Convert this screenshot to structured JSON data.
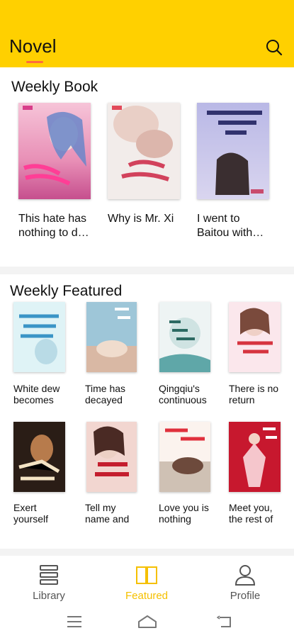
{
  "header": {
    "title": "Novel",
    "search_icon": "search-icon",
    "background": "#ffd000",
    "accent": "#ff6b3d"
  },
  "weekly_book": {
    "title": "Weekly Book",
    "books": [
      {
        "title": "This hate has nothing to do with the wind"
      },
      {
        "title": "Why is Mr. Xi"
      },
      {
        "title": "I went to Baitou with you"
      }
    ]
  },
  "weekly_featured": {
    "title": "Weekly Featured",
    "books": [
      {
        "title": "White dew becomes"
      },
      {
        "title": "Time has decayed"
      },
      {
        "title": "Qingqiu's continuous"
      },
      {
        "title": "There is no return"
      },
      {
        "title": "Exert yourself"
      },
      {
        "title": "Tell my name and"
      },
      {
        "title": "Love you is nothing"
      },
      {
        "title": "Meet you, the rest of"
      }
    ]
  },
  "bottom_nav": {
    "items": [
      {
        "label": "Library",
        "icon": "library-icon",
        "active": false
      },
      {
        "label": "Featured",
        "icon": "book-open-icon",
        "active": true
      },
      {
        "label": "Profile",
        "icon": "profile-icon",
        "active": false
      }
    ],
    "active_color": "#f5c000"
  },
  "system_bar": {
    "buttons": [
      "menu-icon",
      "home-icon",
      "back-icon"
    ]
  }
}
